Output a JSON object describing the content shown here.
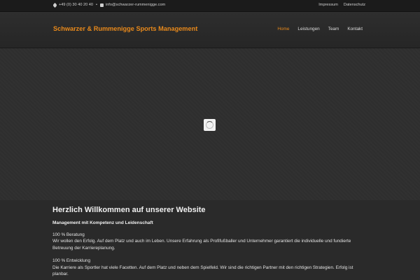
{
  "topbar": {
    "phone": "+49 (0) 30 40 20 40",
    "separator": "•",
    "email": "info@schwarzer-rummenigge.com",
    "links": [
      "Impressum",
      "Datenschutz"
    ]
  },
  "header": {
    "brand": "Schwarzer & Rummenigge Sports Management",
    "nav": [
      {
        "label": "Home",
        "active": true
      },
      {
        "label": "Leistungen",
        "active": false
      },
      {
        "label": "Team",
        "active": false
      },
      {
        "label": "Kontakt",
        "active": false
      }
    ],
    "accent_color": "#e8891b"
  },
  "content": {
    "title": "Herzlich Willkommen auf unserer Website",
    "subtitle": "Management mit Kompetenz und Leidenschaft",
    "sections": [
      {
        "heading": "100 % Beratung",
        "text": "Wir wollen den Erfolg. Auf dem Platz und auch im Leben. Unsere Erfahrung als Profifußballer und Unternehmer garantiert die individuelle und fundierte Betreuung der Karriereplanung."
      },
      {
        "heading": "100 % Entwicklung",
        "text": "Die Karriere als Sportler hat viele Facetten. Auf dem Platz und neben dem Spielfeld. Wir sind die richtigen Partner mit den richtigen Strategien. Erfolg ist planbar."
      }
    ]
  }
}
